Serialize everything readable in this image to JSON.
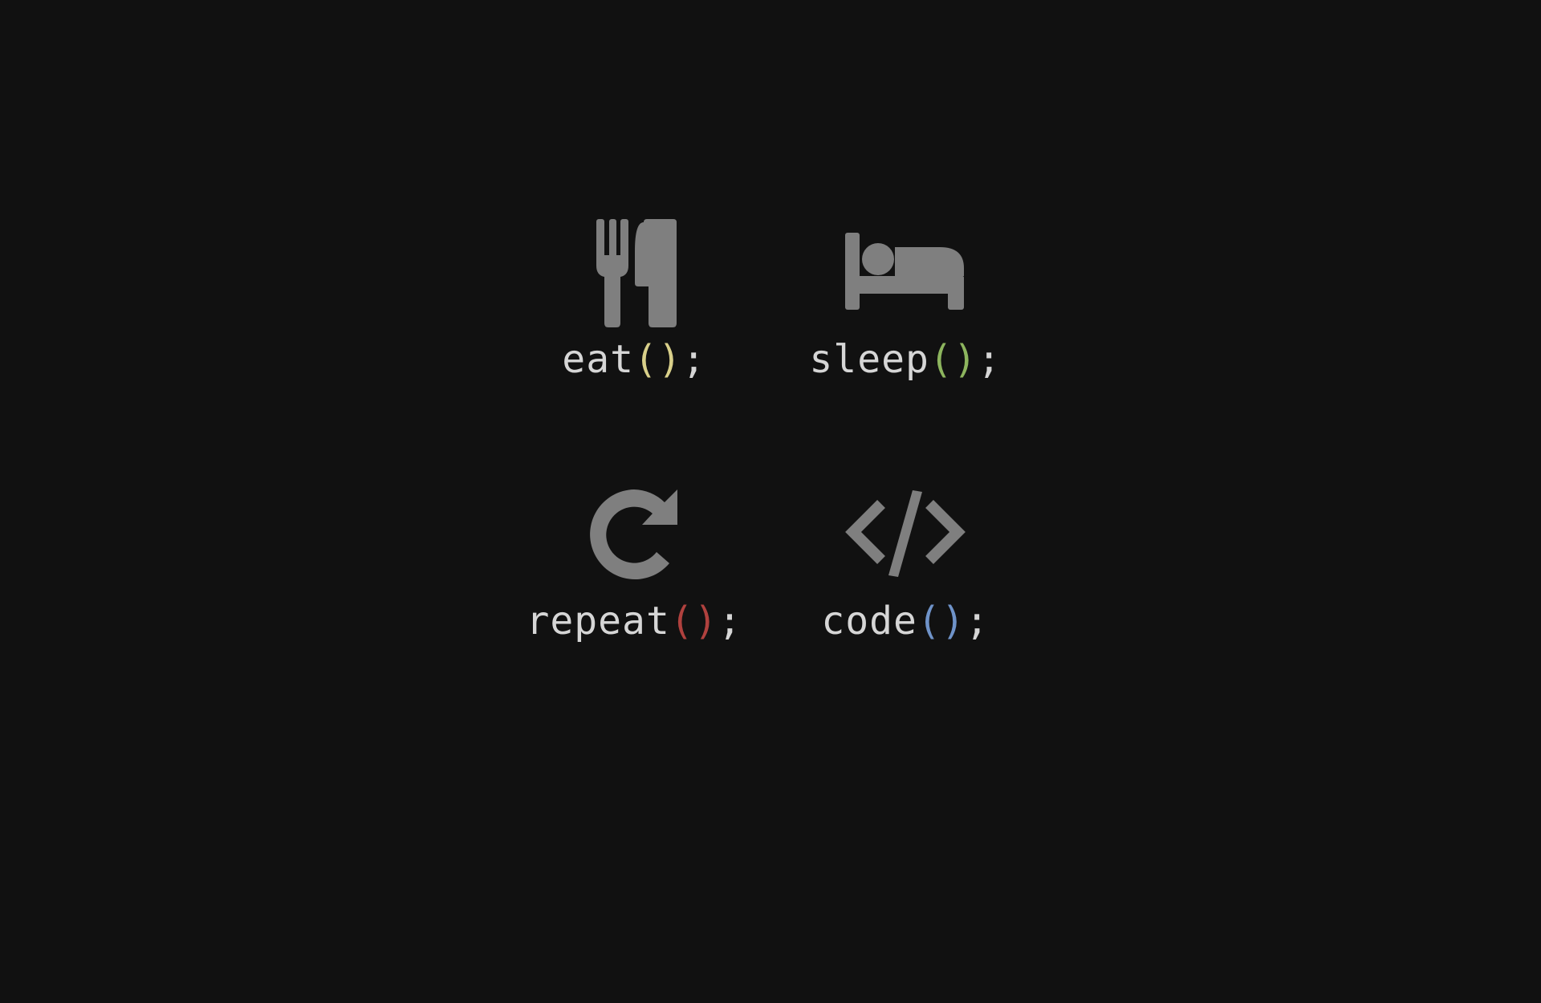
{
  "colors": {
    "background": "#111111",
    "icon": "#7f7f7f",
    "label_text": "#d6d6d6",
    "eat_parens": "#d9d08a",
    "sleep_parens": "#8db55e",
    "repeat_parens": "#b0413e",
    "code_parens": "#6f93c9"
  },
  "tiles": [
    {
      "icon": "fork-knife-icon",
      "name": "eat",
      "parens": "()",
      "semicolon": ";"
    },
    {
      "icon": "bed-icon",
      "name": "sleep",
      "parens": "()",
      "semicolon": ";"
    },
    {
      "icon": "refresh-icon",
      "name": "repeat",
      "parens": "()",
      "semicolon": ";"
    },
    {
      "icon": "code-icon",
      "name": "code",
      "parens": "()",
      "semicolon": ";"
    }
  ]
}
